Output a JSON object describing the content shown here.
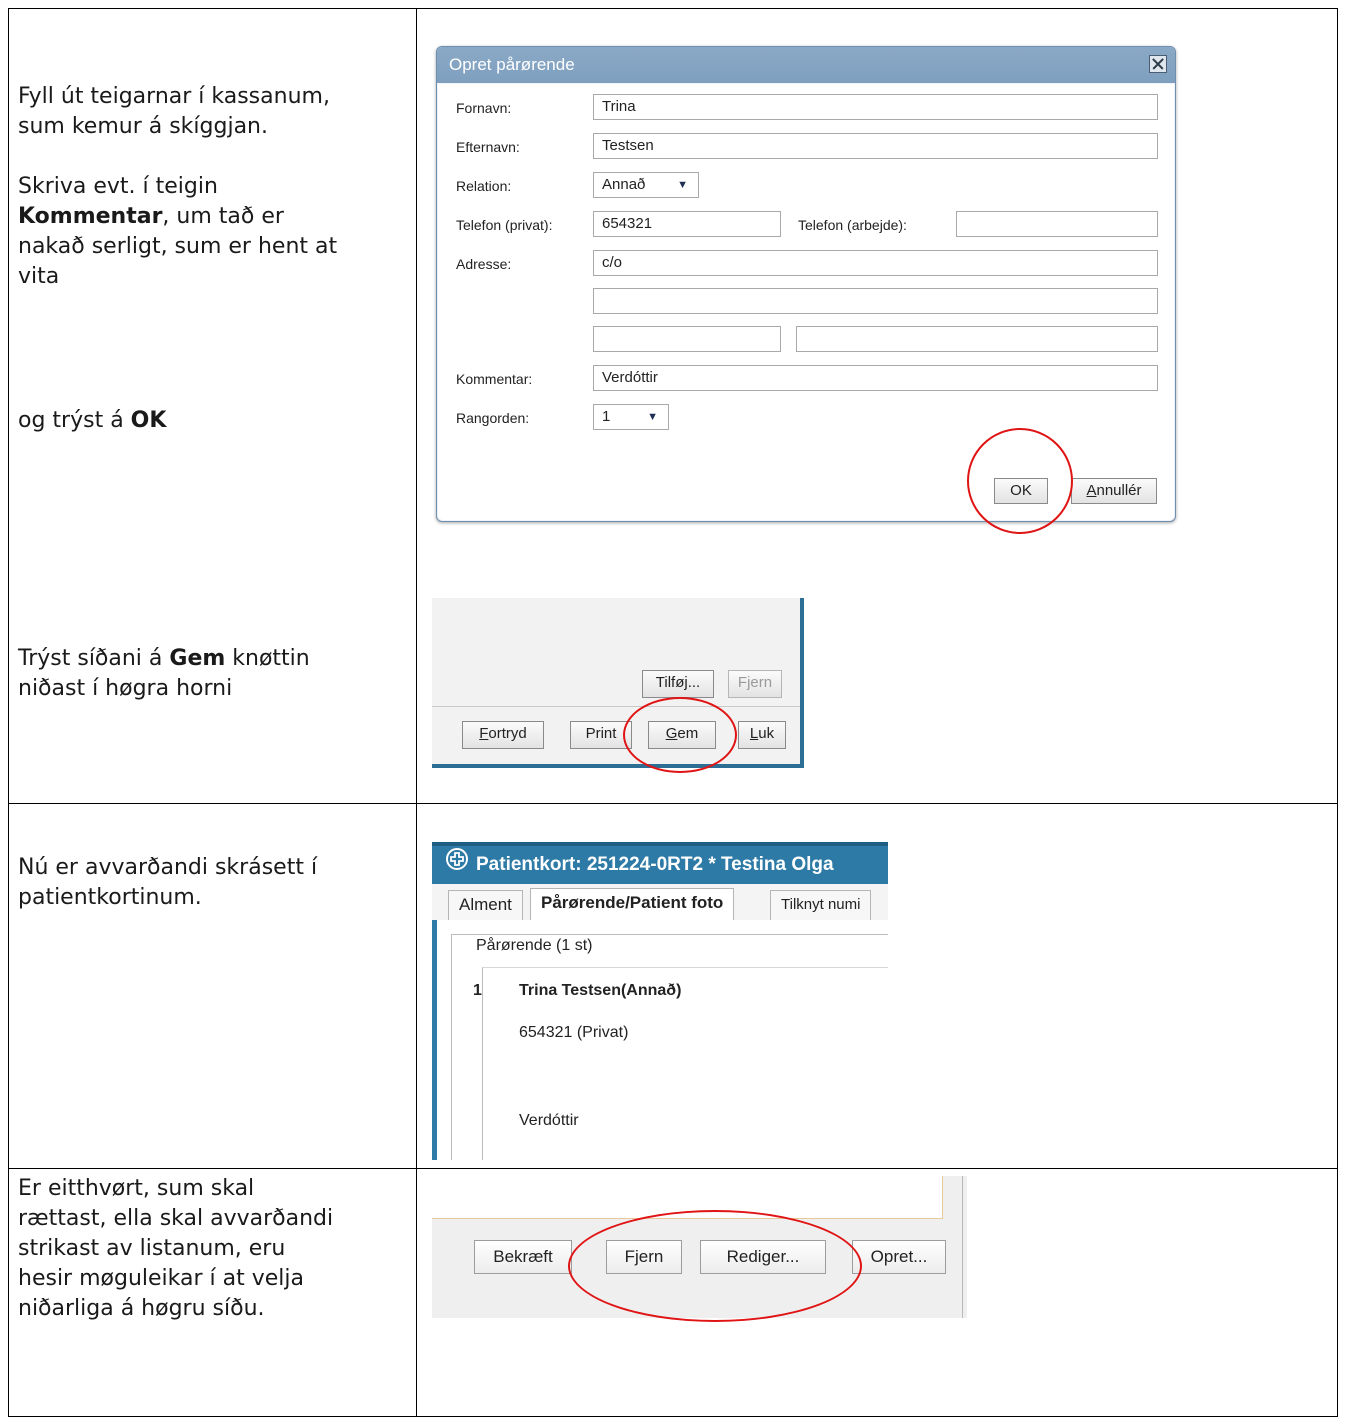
{
  "instructions": {
    "row1_top": {
      "line1": "Fyll út teigarnar í kassanum,",
      "line2": "sum kemur á skíggjan.",
      "p2_line1": "Skriva evt. í teigin",
      "p2_bold": "Kommentar",
      "p2_line2_rest": ", um tað er",
      "p2_line3": "nakað serligt, sum er hent at",
      "p2_line4": "vita",
      "p3_pre": "og trýst á ",
      "p3_bold": "OK"
    },
    "row1_bottom": {
      "pre": "Trýst síðani á ",
      "bold": "Gem",
      "post": " knøttin",
      "line2": "niðast í høgra horni"
    },
    "row2": {
      "line1": "Nú er avvarðandi skrásett í",
      "line2": "patientkortinum."
    },
    "row3": {
      "line1": "Er eitthvørt, sum skal",
      "line2": "rættast, ella skal avvarðandi",
      "line3": "strikast av listanum, eru",
      "line4": "hesir møguleikar í at velja",
      "line5": "niðarliga á høgru síðu."
    }
  },
  "dialog": {
    "title": "Opret pårørende",
    "labels": {
      "fornavn": "Fornavn:",
      "efternavn": "Efternavn:",
      "relation": "Relation:",
      "telefon_privat": "Telefon (privat):",
      "telefon_arbejde": "Telefon (arbejde):",
      "adresse": "Adresse:",
      "kommentar": "Kommentar:",
      "rangorden": "Rangorden:"
    },
    "values": {
      "fornavn": "Trina",
      "efternavn": "Testsen",
      "relation": "Annað",
      "telefon_privat": "654321",
      "telefon_arbejde": "",
      "adresse1": "c/o",
      "adresse2": "",
      "postnr": "",
      "by": "",
      "kommentar": "Verdóttir",
      "rangorden": "1"
    },
    "buttons": {
      "ok": "OK",
      "annuller_first": "A",
      "annuller_rest": "nnullér"
    }
  },
  "toolbar": {
    "tilfoj": "Tilføj...",
    "fjern": "Fjern",
    "fortryd_first": "F",
    "fortryd_rest": "ortryd",
    "print": "Print",
    "gem_first": "G",
    "gem_rest": "em",
    "luk_first": "L",
    "luk_rest": "uk"
  },
  "patient_card": {
    "title": "Patientkort: 251224-0RT2 * Testina Olga",
    "tabs": [
      "Alment",
      "Pårørende/Patient foto",
      "Tilknyt numi"
    ],
    "group_label": "Pårørende (1 st)",
    "entry": {
      "rank": "1",
      "name": "Trina Testsen(Annað)",
      "phone": "654321 (Privat)",
      "comment": "Verdóttir"
    }
  },
  "bottom_buttons": {
    "bekraeft": "Bekræft",
    "fjern": "Fjern",
    "rediger": "Rediger...",
    "opret": "Opret..."
  },
  "colors": {
    "dialog_title_bar": "#8aa9c6",
    "app_blue": "#2e7aa6",
    "highlight_ring": "#e01414"
  }
}
